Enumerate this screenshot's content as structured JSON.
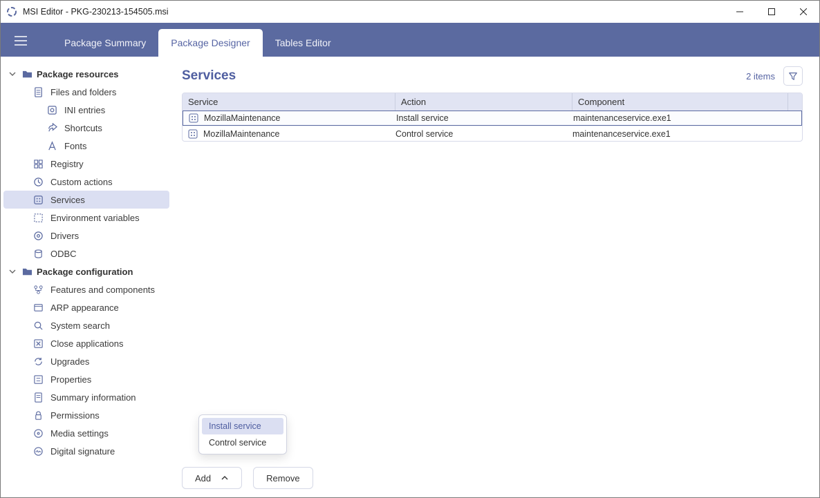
{
  "window": {
    "title": "MSI Editor - PKG-230213-154505.msi"
  },
  "tabs": {
    "summary": "Package Summary",
    "designer": "Package Designer",
    "tables": "Tables Editor"
  },
  "sidebar": {
    "group_resources": "Package resources",
    "files": "Files and folders",
    "ini": "INI entries",
    "shortcuts": "Shortcuts",
    "fonts": "Fonts",
    "registry": "Registry",
    "custom": "Custom actions",
    "services": "Services",
    "env": "Environment variables",
    "drivers": "Drivers",
    "odbc": "ODBC",
    "group_config": "Package configuration",
    "features": "Features and components",
    "arp": "ARP appearance",
    "search": "System search",
    "closeapps": "Close applications",
    "upgrades": "Upgrades",
    "properties": "Properties",
    "summaryinfo": "Summary information",
    "permissions": "Permissions",
    "media": "Media settings",
    "digsig": "Digital signature"
  },
  "page": {
    "title": "Services",
    "count": "2 items"
  },
  "table": {
    "headers": {
      "service": "Service",
      "action": "Action",
      "component": "Component"
    },
    "rows": [
      {
        "service": "MozillaMaintenance",
        "action": "Install service",
        "component": "maintenanceservice.exe1"
      },
      {
        "service": "MozillaMaintenance",
        "action": "Control service",
        "component": "maintenanceservice.exe1"
      }
    ]
  },
  "popup": {
    "install": "Install service",
    "control": "Control service"
  },
  "buttons": {
    "add": "Add",
    "remove": "Remove"
  }
}
